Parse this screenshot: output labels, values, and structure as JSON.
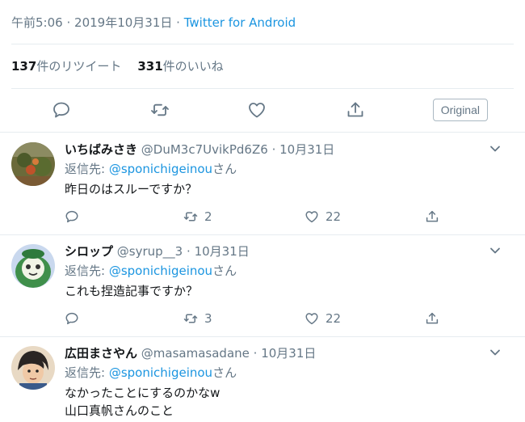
{
  "tweet": {
    "time": "午前5:06",
    "separator": "·",
    "date": "2019年10月31日",
    "source": "Twitter for Android",
    "retweets_count": "137",
    "retweets_label": "件のリツイート",
    "likes_count": "331",
    "likes_label": "件のいいね",
    "actions": {
      "reply_icon": "reply-icon",
      "retweet_icon": "retweet-icon",
      "like_icon": "heart-icon",
      "share_icon": "share-icon",
      "original_label": "Original"
    }
  },
  "replies": [
    {
      "name": "いちばみさき",
      "handle": "@DuM3c7UvikPd6Z6",
      "separator": "·",
      "date": "10月31日",
      "reply_to_prefix": "返信先:",
      "reply_to_handle": "@sponichigeinou",
      "reply_to_suffix": "さん",
      "text_lines": [
        "昨日のはスルーですか？"
      ],
      "retweets": "2",
      "likes": "22"
    },
    {
      "name": "シロップ",
      "handle": "@syrup__3",
      "separator": "·",
      "date": "10月31日",
      "reply_to_prefix": "返信先:",
      "reply_to_handle": "@sponichigeinou",
      "reply_to_suffix": "さん",
      "text_lines": [
        "これも捏造記事ですか？"
      ],
      "retweets": "3",
      "likes": "22"
    },
    {
      "name": "広田まさやん",
      "handle": "@masamasadane",
      "separator": "·",
      "date": "10月31日",
      "reply_to_prefix": "返信先:",
      "reply_to_handle": "@sponichigeinou",
      "reply_to_suffix": "さん",
      "text_lines": [
        "なかったことにするのかなw",
        "山口真帆さんのこと"
      ]
    }
  ],
  "colors": {
    "link": "#1b95e0",
    "muted": "#657786",
    "text": "#14171a",
    "divider": "#e6ecf0"
  }
}
